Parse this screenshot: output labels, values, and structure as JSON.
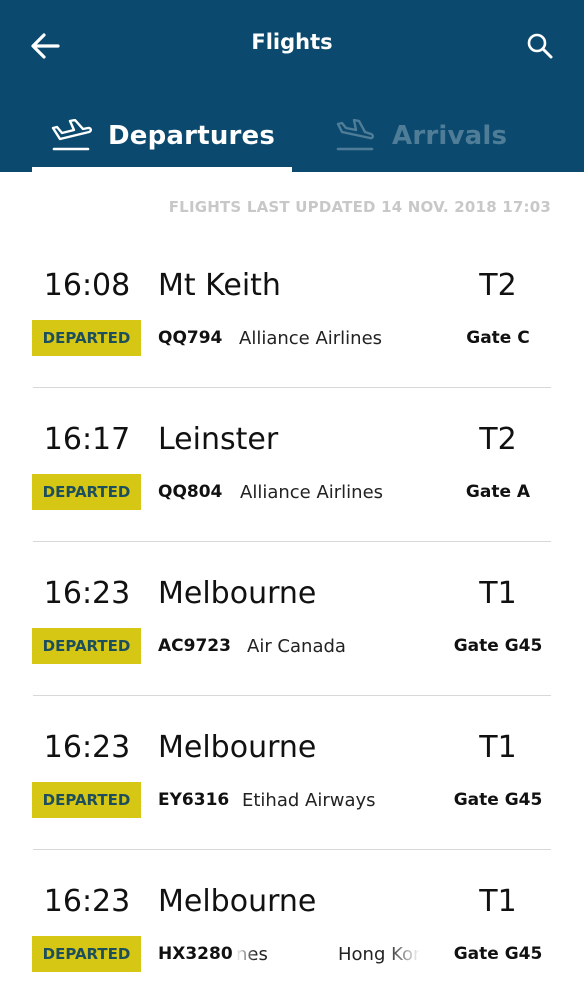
{
  "header": {
    "title": "Flights",
    "back_icon": "arrow-left-icon",
    "search_icon": "search-icon"
  },
  "tabs": [
    {
      "label": "Departures",
      "icon": "plane-takeoff-icon",
      "active": true
    },
    {
      "label": "Arrivals",
      "icon": "plane-landing-icon",
      "active": false
    }
  ],
  "updated_text": "FLIGHTS LAST UPDATED 14 NOV. 2018 17:03",
  "colors": {
    "header_bg": "#0b4a6e",
    "status_bg": "#d7c715",
    "status_text": "#1d4e5b"
  },
  "flights": [
    {
      "time": "16:08",
      "destination": "Mt Keith",
      "terminal": "T2",
      "status": "DEPARTED",
      "flight": "QQ794",
      "airline": "Alliance Airlines",
      "gate": "Gate C"
    },
    {
      "time": "16:17",
      "destination": "Leinster",
      "terminal": "T2",
      "status": "DEPARTED",
      "flight": "QQ804",
      "airline": "Alliance Airlines",
      "gate": "Gate A"
    },
    {
      "time": "16:23",
      "destination": "Melbourne",
      "terminal": "T1",
      "status": "DEPARTED",
      "flight": "AC9723",
      "airline": "Air Canada",
      "gate": "Gate G45"
    },
    {
      "time": "16:23",
      "destination": "Melbourne",
      "terminal": "T1",
      "status": "DEPARTED",
      "flight": "EY6316",
      "airline": "Etihad Airways",
      "gate": "Gate G45"
    },
    {
      "time": "16:23",
      "destination": "Melbourne",
      "terminal": "T1",
      "status": "DEPARTED",
      "flight": "HX3280",
      "airline": "nes",
      "airline_2": "Hong Kor",
      "gate": "Gate G45"
    }
  ]
}
